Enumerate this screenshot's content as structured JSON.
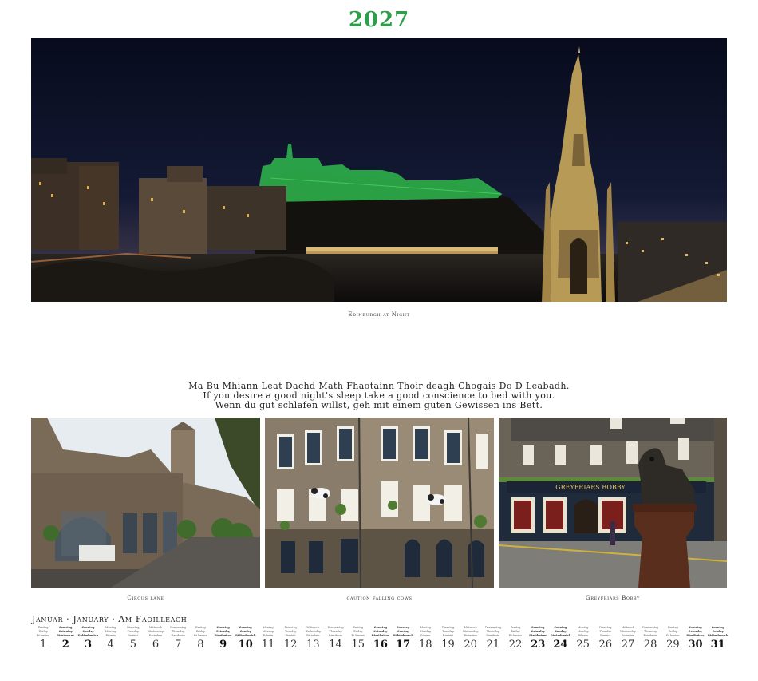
{
  "year": "2027",
  "main_photo": {
    "caption": "Edinburgh at Night"
  },
  "proverb": {
    "line1": "Ma Bu Mhiann Leat Dachd Math Fhaotainn Thoir deagh Chogais Do D Leabadh.",
    "line2": "If you desire a good night's sleep take a good conscience to bed with you.",
    "line3": "Wenn du gut schlafen willst, geh mit einem guten Gewissen ins Bett."
  },
  "photos": [
    {
      "caption": "Circus lane"
    },
    {
      "caption": "caution falling cows"
    },
    {
      "caption": "Greyfriars Bobby"
    }
  ],
  "pub_sign": "GREYFRIARS BOBBY",
  "month_title": "Januar · January · Am Faoilleach",
  "days": [
    {
      "n": "1",
      "de": "Freitag",
      "en": "Friday",
      "gd": "Di-haoine",
      "we": false
    },
    {
      "n": "2",
      "de": "Samstag",
      "en": "Saturday",
      "gd": "Disathairne",
      "we": true
    },
    {
      "n": "3",
      "de": "Sonntag",
      "en": "Sunday",
      "gd": "Didòmhnaich",
      "we": true
    },
    {
      "n": "4",
      "de": "Montag",
      "en": "Monday",
      "gd": "Diluain",
      "we": false
    },
    {
      "n": "5",
      "de": "Dienstag",
      "en": "Tuesday",
      "gd": "Dimàirt",
      "we": false
    },
    {
      "n": "6",
      "de": "Mittwoch",
      "en": "Wednesday",
      "gd": "Diciadain",
      "we": false
    },
    {
      "n": "7",
      "de": "Donnerstag",
      "en": "Thursday",
      "gd": "Diardaoin",
      "we": false
    },
    {
      "n": "8",
      "de": "Freitag",
      "en": "Friday",
      "gd": "Di-haoine",
      "we": false
    },
    {
      "n": "9",
      "de": "Samstag",
      "en": "Saturday",
      "gd": "Disathairne",
      "we": true
    },
    {
      "n": "10",
      "de": "Sonntag",
      "en": "Sunday",
      "gd": "Didòmhnaich",
      "we": true
    },
    {
      "n": "11",
      "de": "Montag",
      "en": "Monday",
      "gd": "Diluain",
      "we": false
    },
    {
      "n": "12",
      "de": "Dienstag",
      "en": "Tuesday",
      "gd": "Dimàirt",
      "we": false
    },
    {
      "n": "13",
      "de": "Mittwoch",
      "en": "Wednesday",
      "gd": "Diciadain",
      "we": false
    },
    {
      "n": "14",
      "de": "Donnerstag",
      "en": "Thursday",
      "gd": "Diardaoin",
      "we": false
    },
    {
      "n": "15",
      "de": "Freitag",
      "en": "Friday",
      "gd": "Di-haoine",
      "we": false
    },
    {
      "n": "16",
      "de": "Samstag",
      "en": "Saturday",
      "gd": "Disathairne",
      "we": true
    },
    {
      "n": "17",
      "de": "Sonntag",
      "en": "Sunday",
      "gd": "Didòmhnaich",
      "we": true
    },
    {
      "n": "18",
      "de": "Montag",
      "en": "Monday",
      "gd": "Diluain",
      "we": false
    },
    {
      "n": "19",
      "de": "Dienstag",
      "en": "Tuesday",
      "gd": "Dimàirt",
      "we": false
    },
    {
      "n": "20",
      "de": "Mittwoch",
      "en": "Wednesday",
      "gd": "Diciadain",
      "we": false
    },
    {
      "n": "21",
      "de": "Donnerstag",
      "en": "Thursday",
      "gd": "Diardaoin",
      "we": false
    },
    {
      "n": "22",
      "de": "Freitag",
      "en": "Friday",
      "gd": "Di-haoine",
      "we": false
    },
    {
      "n": "23",
      "de": "Samstag",
      "en": "Saturday",
      "gd": "Disathairne",
      "we": true
    },
    {
      "n": "24",
      "de": "Sonntag",
      "en": "Sunday",
      "gd": "Didòmhnaich",
      "we": true
    },
    {
      "n": "25",
      "de": "Montag",
      "en": "Monday",
      "gd": "Diluain",
      "we": false
    },
    {
      "n": "26",
      "de": "Dienstag",
      "en": "Tuesday",
      "gd": "Dimàirt",
      "we": false
    },
    {
      "n": "27",
      "de": "Mittwoch",
      "en": "Wednesday",
      "gd": "Diciadain",
      "we": false
    },
    {
      "n": "28",
      "de": "Donnerstag",
      "en": "Thursday",
      "gd": "Diardaoin",
      "we": false
    },
    {
      "n": "29",
      "de": "Freitag",
      "en": "Friday",
      "gd": "Di-haoine",
      "we": false
    },
    {
      "n": "30",
      "de": "Samstag",
      "en": "Saturday",
      "gd": "Disathairne",
      "we": true
    },
    {
      "n": "31",
      "de": "Sonntag",
      "en": "Sunday",
      "gd": "Didòmhnaich",
      "we": true
    }
  ]
}
